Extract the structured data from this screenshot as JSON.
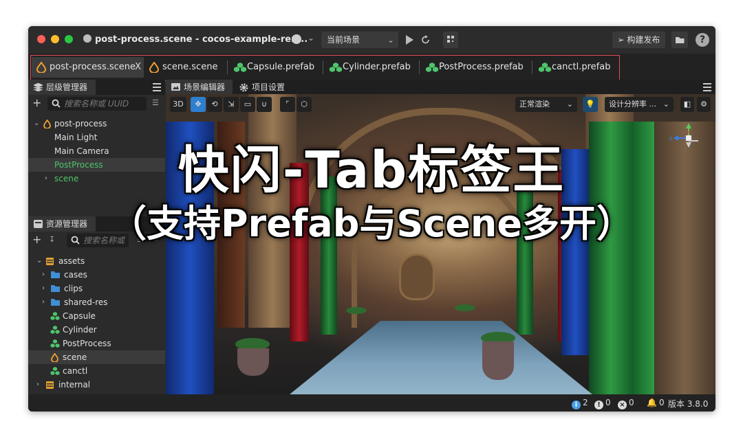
{
  "window": {
    "title": "post-process.scene - cocos-example-ren...",
    "scene_select": "当前场景",
    "publish_label": "构建发布",
    "help": "?"
  },
  "tabs": [
    {
      "label": "post-process.scene",
      "close": "X",
      "icon": "scene-icon"
    },
    {
      "label": "scene.scene",
      "icon": "scene-icon"
    },
    {
      "label": "Capsule.prefab",
      "icon": "prefab-icon"
    },
    {
      "label": "Cylinder.prefab",
      "icon": "prefab-icon"
    },
    {
      "label": "PostProcess.prefab",
      "icon": "prefab-icon"
    },
    {
      "label": "canctl.prefab",
      "icon": "prefab-icon"
    }
  ],
  "hierarchy": {
    "title": "层级管理器",
    "search_placeholder": "搜索名称或 UUID",
    "items": [
      {
        "label": "post-process"
      },
      {
        "label": "Main Light"
      },
      {
        "label": "Main Camera"
      },
      {
        "label": "PostProcess"
      },
      {
        "label": "scene"
      }
    ]
  },
  "assets": {
    "title": "资源管理器",
    "search_placeholder": "搜索名称或",
    "items": [
      {
        "label": "assets"
      },
      {
        "label": "cases"
      },
      {
        "label": "clips"
      },
      {
        "label": "shared-res"
      },
      {
        "label": "Capsule"
      },
      {
        "label": "Cylinder"
      },
      {
        "label": "PostProcess"
      },
      {
        "label": "scene"
      },
      {
        "label": "canctl"
      },
      {
        "label": "internal"
      }
    ]
  },
  "editor": {
    "tab_scene": "场景编辑器",
    "tab_project": "项目设置",
    "btn_3d": "3D",
    "render_mode": "正常渲染",
    "resolution": "设计分辨率 ...",
    "gizmo_z": "z"
  },
  "overlay": {
    "line1": "快闪-Tab标签王",
    "line2": "（支持Prefab与Scene多开）"
  },
  "status": {
    "info_count": "2",
    "warn_count": "0",
    "error_count": "0",
    "notify_count": "0",
    "version": "版本 3.8.0"
  },
  "colors": {
    "tab_highlight": "#e54d5a",
    "prefab_green": "#4ec46b",
    "scene_orange": "#f0a030",
    "selection_blue": "#2f7fd0"
  }
}
